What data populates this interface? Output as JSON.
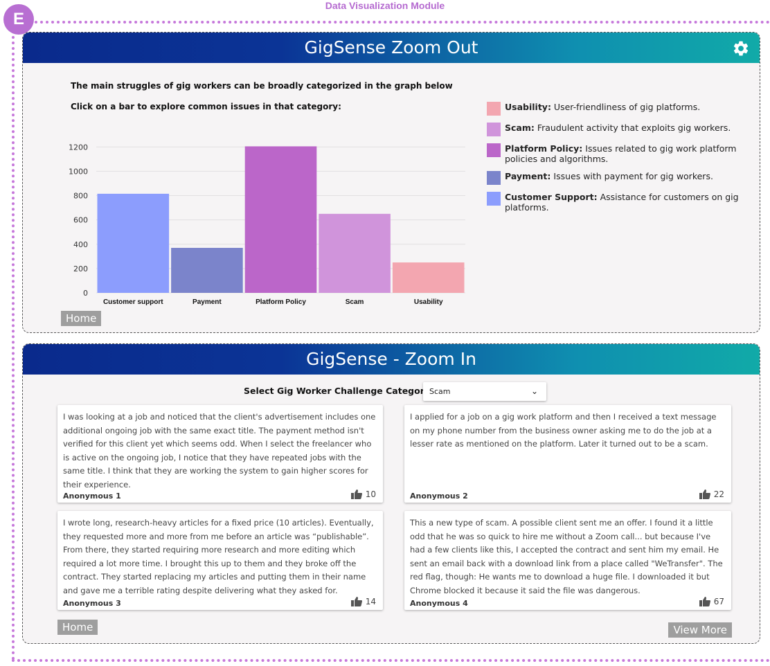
{
  "module_title": "Data Visualization Module",
  "badge_letter": "E",
  "zoom_out": {
    "title": "GigSense Zoom Out",
    "intro_line1": "The main struggles of gig workers can be broadly categorized in the graph below",
    "intro_line2": "Click on a bar to explore common issues in that category:",
    "home_label": "Home",
    "legend": [
      {
        "name": "Usability:",
        "desc": "User-friendliness of gig platforms.",
        "color": "#f3a6b0"
      },
      {
        "name": "Scam:",
        "desc": "Fraudulent activity that exploits gig workers.",
        "color": "#d094db"
      },
      {
        "name": "Platform Policy:",
        "desc": "Issues related to gig work platform policies and algorithms.",
        "color": "#bb66c9"
      },
      {
        "name": "Payment:",
        "desc": "Issues with payment for gig workers.",
        "color": "#7b84cb"
      },
      {
        "name": "Customer Support:",
        "desc": "Assistance for customers on gig platforms.",
        "color": "#8c9dfd"
      }
    ]
  },
  "chart_data": {
    "type": "bar",
    "categories": [
      "Customer support",
      "Payment",
      "Platform Policy",
      "Scam",
      "Usability"
    ],
    "values": [
      815,
      370,
      1205,
      650,
      250
    ],
    "colors": [
      "#8c9dfd",
      "#7b84cb",
      "#bb66c9",
      "#d094db",
      "#f3a6b0"
    ],
    "yticks": [
      0,
      200,
      400,
      600,
      800,
      1000,
      1200
    ],
    "ylim": [
      0,
      1230
    ],
    "grid": true
  },
  "zoom_in": {
    "title": "GigSense - Zoom In",
    "select_label": "Select Gig Worker Challenge Category:",
    "select_value": "Scam",
    "home_label": "Home",
    "view_more_label": "View More",
    "cards": [
      {
        "text": "I was looking at a job and noticed that the client's advertisement includes one additional ongoing job with the same exact title. The payment method isn't verified for this client yet which seems odd. When I select the freelancer who is active on the ongoing job, I notice that they have repeated jobs with the same title. I think that they are working the system to gain higher scores for their experience.",
        "author": "Anonymous 1",
        "likes": "10"
      },
      {
        "text": "I applied for a job on a gig work platform and then I received a text message on my phone number from the business owner asking me to do the job at a lesser rate as mentioned on the platform. Later it turned out to be a scam.",
        "author": "Anonymous 2",
        "likes": "22"
      },
      {
        "text": "I wrote long, research-heavy articles for a fixed price (10 articles). Eventually, they requested more and more from me before an article was “publishable”. From there, they started requiring more research and more editing which required a lot more time. I brought this up to them and they broke off the contract. They started replacing my articles and putting them in their name and gave me a terrible rating despite delivering what they asked for.",
        "author": "Anonymous 3",
        "likes": "14"
      },
      {
        "text": "This a new type of scam. A possible client sent me an offer. I found it a little odd that he was so quick to hire me without a Zoom call... but because I've had a few clients like this,  I accepted the contract and sent him my email. He sent an email back with a download link from a place called \"WeTransfer\". The red flag, though: He wants me to download a huge file. I downloaded it but Chrome blocked it because it said the file was dangerous.",
        "author": "Anonymous 4",
        "likes": "67"
      }
    ]
  }
}
